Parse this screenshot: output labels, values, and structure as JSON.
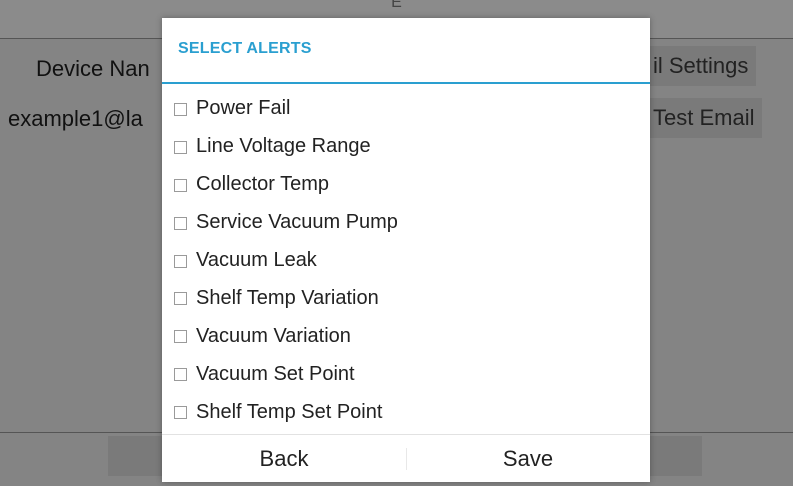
{
  "background": {
    "title": "E",
    "device_name_label": "Device Nan",
    "email_settings_button": "il Settings",
    "email_value": "example1@la",
    "test_email_button": "Test Email"
  },
  "dialog": {
    "title": "SELECT ALERTS",
    "options": [
      {
        "label": "Power Fail",
        "checked": false
      },
      {
        "label": "Line Voltage Range",
        "checked": false
      },
      {
        "label": "Collector Temp",
        "checked": false
      },
      {
        "label": "Service Vacuum Pump",
        "checked": false
      },
      {
        "label": "Vacuum Leak",
        "checked": false
      },
      {
        "label": "Shelf Temp Variation",
        "checked": false
      },
      {
        "label": "Vacuum Variation",
        "checked": false
      },
      {
        "label": "Vacuum Set Point",
        "checked": false
      },
      {
        "label": "Shelf Temp Set Point",
        "checked": false
      }
    ],
    "back_label": "Back",
    "save_label": "Save"
  },
  "colors": {
    "accent": "#2a9fd0",
    "dim_background": "#848484"
  }
}
